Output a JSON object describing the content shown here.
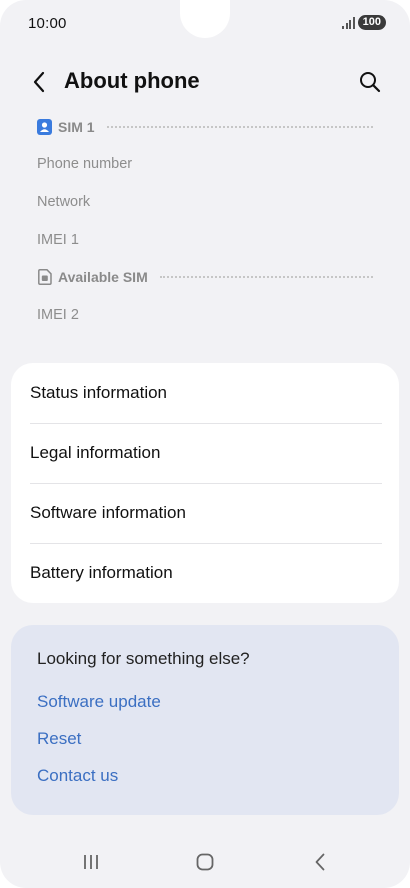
{
  "status_bar": {
    "time": "10:00",
    "battery": "100"
  },
  "header": {
    "title": "About phone",
    "back_icon": "chevron-left-icon",
    "search_icon": "search-icon"
  },
  "sim_info": {
    "sim1_label": "SIM 1",
    "phone_number_label": "Phone number",
    "network_label": "Network",
    "imei1_label": "IMEI 1",
    "sim2_label": "Available SIM",
    "imei2_label": "IMEI 2"
  },
  "menu": {
    "items": [
      {
        "label": "Status information"
      },
      {
        "label": "Legal information"
      },
      {
        "label": "Software information"
      },
      {
        "label": "Battery information"
      }
    ]
  },
  "suggestions": {
    "title": "Looking for something else?",
    "links": [
      {
        "label": "Software update"
      },
      {
        "label": "Reset"
      },
      {
        "label": "Contact us"
      }
    ]
  },
  "colors": {
    "accent": "#3b6fc2",
    "sim_badge": "#3a7bde",
    "background": "#f2f2f5",
    "card": "#ffffff",
    "suggest_card": "#e2e6f2"
  }
}
